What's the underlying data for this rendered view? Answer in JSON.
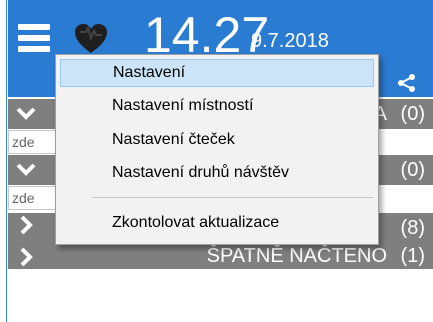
{
  "header": {
    "time": "14.27",
    "date": "9.7.2018",
    "menu_icon": "hamburger-icon",
    "logo_icon": "heart-icon",
    "share_icon": "share-icon",
    "background_color": "#2a7bd2"
  },
  "groups": [
    {
      "label": "A",
      "count": "(0)",
      "expanded": true,
      "icon": "chevron-down-icon"
    },
    {
      "label": "",
      "count": "(0)",
      "expanded": true,
      "icon": "chevron-down-icon"
    },
    {
      "label": "",
      "count": "(8)",
      "expanded": false,
      "icon": "chevron-right-icon"
    },
    {
      "label": "ŠPATNĚ NAČTENO",
      "count": "(1)",
      "expanded": false,
      "icon": "chevron-right-icon"
    }
  ],
  "placeholders": [
    "zde",
    "zde"
  ],
  "menu": {
    "items": [
      {
        "label": "Nastavení",
        "highlighted": true
      },
      {
        "label": "Nastavení místností",
        "highlighted": false
      },
      {
        "label": "Nastavení čteček",
        "highlighted": false
      },
      {
        "label": "Nastavení druhů návštěv",
        "highlighted": false
      },
      {
        "label": "Zkontolovat aktualizace",
        "highlighted": false
      }
    ],
    "highlight_color": "#cce4f7"
  },
  "colors": {
    "group_row": "#7f7f7f",
    "accent": "#2a7bd2"
  }
}
